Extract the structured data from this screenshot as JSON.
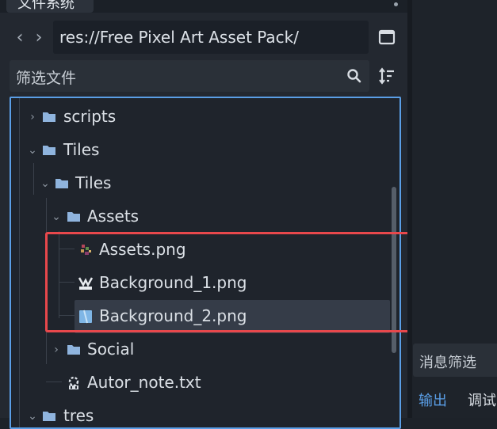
{
  "dock": {
    "tab_title": "文件系统",
    "path": "res://Free Pixel Art Asset Pack/",
    "filter_placeholder": "筛选文件"
  },
  "tree": [
    {
      "label": "scripts",
      "icon": "folder-icon",
      "expanded": false
    },
    {
      "label": "Tiles",
      "icon": "folder-icon",
      "expanded": true
    },
    {
      "label": "Tiles",
      "icon": "folder-icon",
      "expanded": true
    },
    {
      "label": "Assets",
      "icon": "folder-icon",
      "expanded": true
    },
    {
      "label": "Assets.png",
      "icon": "image-thumbnail-icon"
    },
    {
      "label": "Background_1.png",
      "icon": "image-thumbnail-icon"
    },
    {
      "label": "Background_2.png",
      "icon": "image-thumbnail-icon",
      "selected": true
    },
    {
      "label": "Social",
      "icon": "folder-icon",
      "expanded": false
    },
    {
      "label": "Autor_note.txt",
      "icon": "text-file-icon"
    },
    {
      "label": "tres",
      "icon": "folder-icon",
      "expanded": true
    }
  ],
  "output_panel": {
    "filter_placeholder": "消息筛选",
    "tabs": [
      "输出",
      "调试"
    ]
  },
  "colors": {
    "accent": "#5a9ee6",
    "highlight_box": "#e8484c",
    "folder": "#8fb4de",
    "selected_row": "#353c48"
  }
}
